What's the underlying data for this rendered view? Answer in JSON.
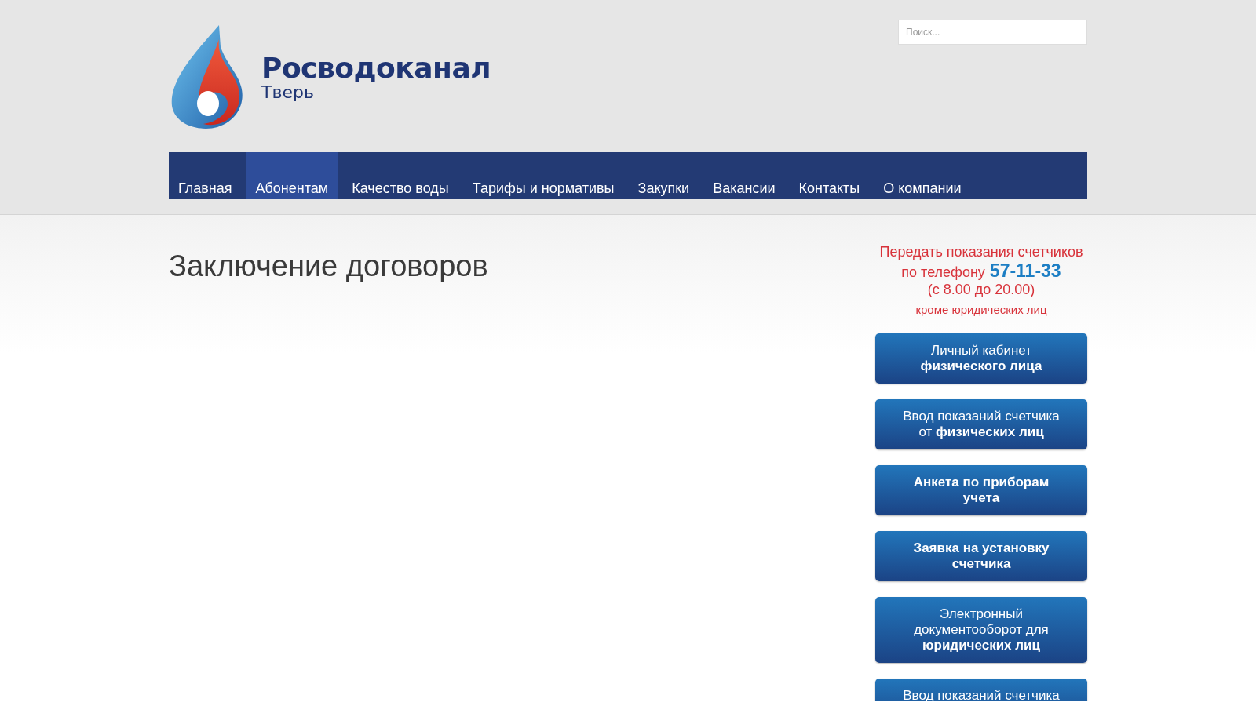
{
  "header": {
    "logo_title": "Росводоканал",
    "logo_subtitle": "Тверь",
    "search": {
      "placeholder": "Поиск..."
    }
  },
  "nav": [
    {
      "label": "Главная",
      "selected": false
    },
    {
      "label": "Абонентам",
      "selected": true
    },
    {
      "label": "Качество воды",
      "selected": false
    },
    {
      "label": "Тарифы и нормативы",
      "selected": false
    },
    {
      "label": "Закупки",
      "selected": false
    },
    {
      "label": "Вакансии",
      "selected": false
    },
    {
      "label": "Контакты",
      "selected": false
    },
    {
      "label": "О компании",
      "selected": false
    }
  ],
  "page_title": "Заключение договоров",
  "sidebar": {
    "notice": {
      "line": "Передать показания счетчиков",
      "phone_label": "по телефону",
      "phone": "57-11-33",
      "hours": "(с 8.00 до 20.00)",
      "note": "кроме юридических лиц"
    },
    "buttons": [
      {
        "text": "Личный кабинет\n**физического лица**",
        "bold": false
      },
      {
        "text": "Ввод показаний счетчика\nот **физических лиц**",
        "bold": false
      },
      {
        "text": "Анкета по приборам\nучета",
        "bold": true
      },
      {
        "text": "Заявка на установку\nсчетчика",
        "bold": true
      },
      {
        "text": "Электронный\nдокументооборот для\n**юридических лиц**",
        "bold": false
      },
      {
        "text": "Ввод показаний счетчика",
        "bold": false
      }
    ]
  }
}
